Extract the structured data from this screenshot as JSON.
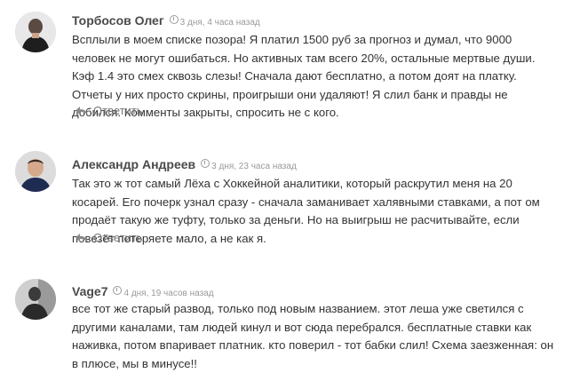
{
  "comments": [
    {
      "author": "Торбосов Олег",
      "time": "3 дня, 4 часа назад",
      "text": "Всплыли в моем списке позора! Я платил 1500 руб за прогноз и думал, что 9000 человек не могут ошибаться. Но активных там всего 20%, остальные мертвые души. Кэф 1.4 это смех сквозь слезы! Сначала дают бесплатно, а потом доят на платку. Отчеты у них просто скрины, проигрыши они удаляют! Я слил банк и правды не добился. Комменты закрыты, спросить не с кого.",
      "reply_label": "Ответить"
    },
    {
      "author": "Александр Андреев",
      "time": "3 дня, 23 часа назад",
      "text": "Так это ж тот самый Лёха с Хоккейной аналитики, который раскрутил меня на 20 косарей. Его почерк узнал сразу - сначала заманивает халявными ставками, а пот ом продаёт такую же туфту, только за деньги. Но на выигрыш не расчитывайте, если повезёт потеряете мало, а не как я.",
      "reply_label": "Ответить"
    },
    {
      "author": "Vage7",
      "time": "4 дня, 19 часов назад",
      "text": "все тот же старый развод, только под новым названием. этот леша уже светился с другими каналами, там людей кинул и вот сюда перебрался. бесплатные ставки как наживка, потом впаривает платник. кто поверил - тот бабки слил! Схема заезженная: он в плюсе, мы в минусе!!"
    }
  ]
}
